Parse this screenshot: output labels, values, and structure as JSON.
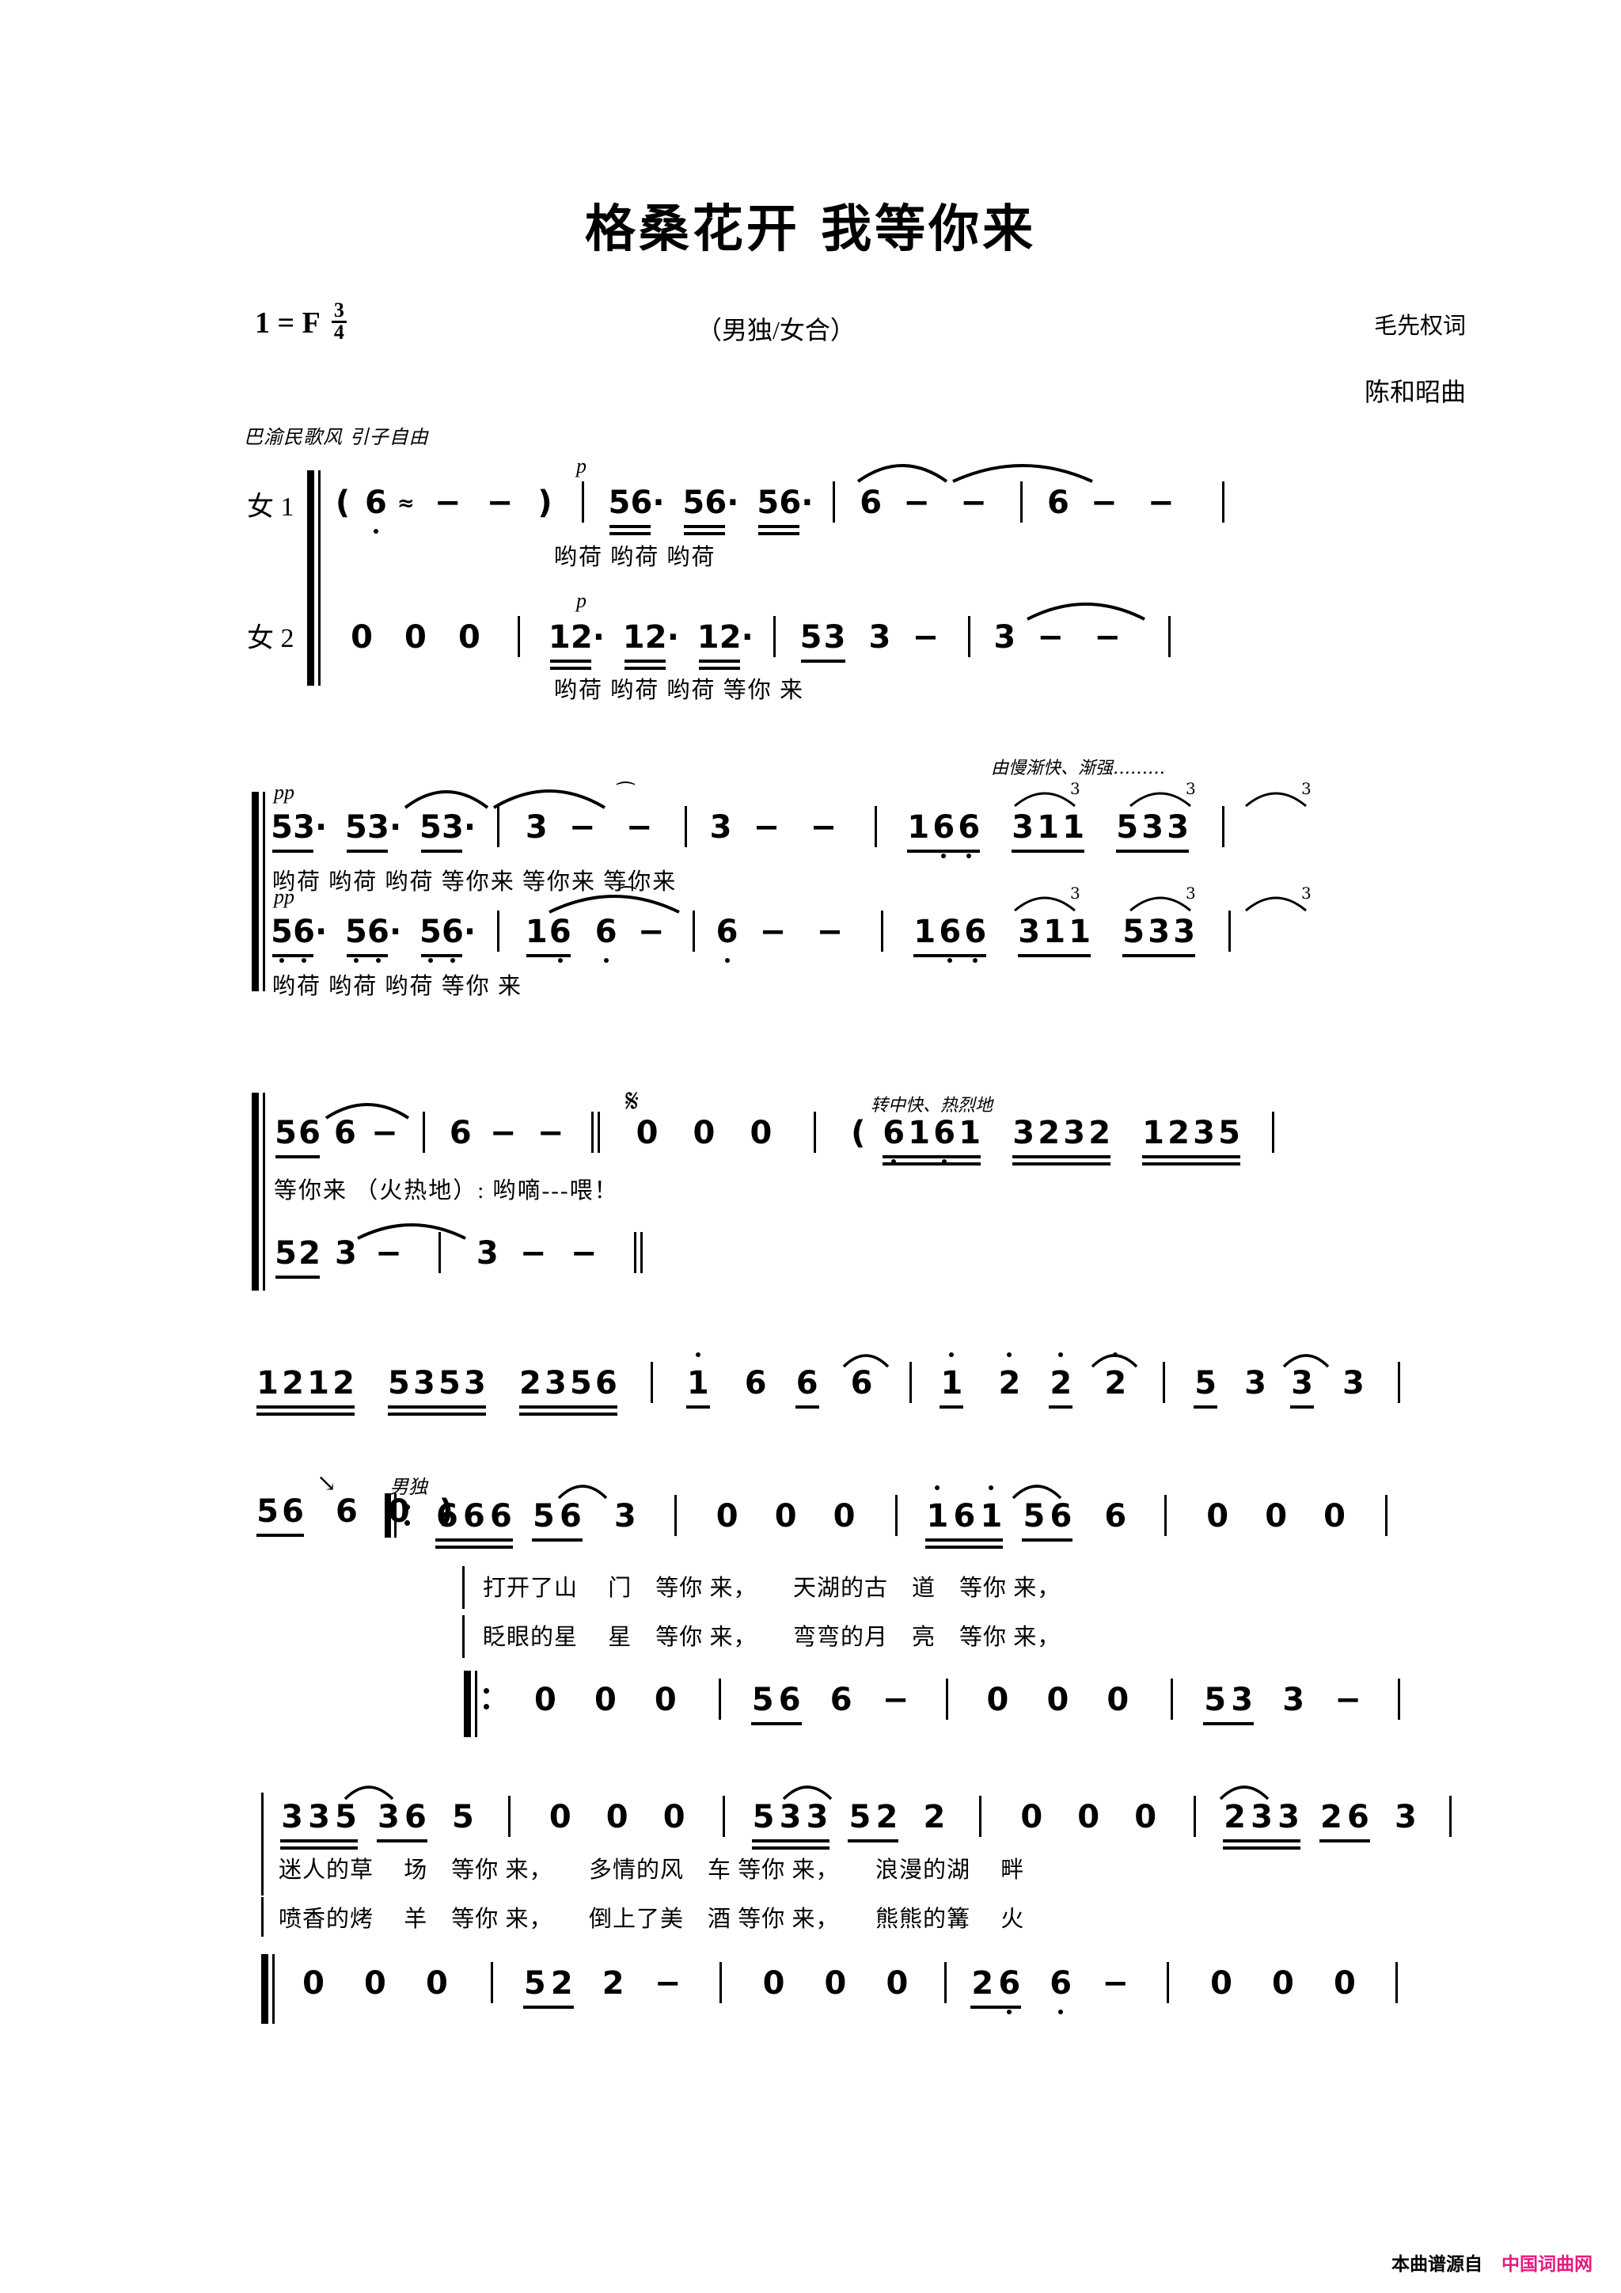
{
  "page": {
    "title": "格桑花开 我等你来",
    "voicing": "（男独/女合）",
    "key_signature": "1 = F",
    "time_numerator": "3",
    "time_denominator": "4",
    "lyricist": "毛先权词",
    "composer": "陈和昭曲",
    "style_note": "巴渝民歌风 引子自由",
    "footer_source": "本曲谱源自",
    "footer_site": "中国词曲网",
    "footer_site_color": "#e8197d"
  },
  "markings": {
    "accel_cresc": "由慢渐快、渐强………",
    "moderato_fervent": "转中快、热烈地",
    "fiery": "（火热地）:",
    "male_solo": "男独",
    "dyn_p": "p",
    "dyn_pp": "pp"
  },
  "voice_labels": {
    "female1": "女 1",
    "female2": "女 2"
  },
  "systems": [
    {
      "id": "system-1",
      "staves": [
        {
          "id": "s1-v1",
          "label": "女 1",
          "notes": "( 6̣ ≈ - - )  | 5 6·  5 6·  5 6· | 6 - - | 6 - - |",
          "lyrics": "哟荷  哟荷  哟荷"
        },
        {
          "id": "s1-v2",
          "label": "女 2",
          "notes": "0  0  0 | 1 2·  1 2·  1 2· | 5 3 3 - | 3 - - |",
          "lyrics": "哟荷  哟荷  哟荷    等你 来"
        }
      ]
    },
    {
      "id": "system-2",
      "staves": [
        {
          "id": "s2-v1",
          "notes": "5 3·  5 3·  5 3· | 3 - - | 3 - - | 1 6 6  3 1 1  5 3 3 |",
          "lyrics": "哟荷  哟荷  哟荷            等你来 等你来 等你来",
          "triplets": [
            "3",
            "3",
            "3"
          ]
        },
        {
          "id": "s2-v2",
          "notes": "5 6·  5 6·  5 6· | 1 6 6 - | 6 - - | 1 6 6  3 1 1  5 3 3 |",
          "lyrics": "哟荷  哟荷  哟荷    等你 来",
          "triplets": [
            "3",
            "3",
            "3"
          ]
        }
      ]
    },
    {
      "id": "system-3",
      "staves": [
        {
          "id": "s3-v1",
          "notes": "5 6 6 - | 6 - - ‖ 0  0  0 | ( 6 1 6 1  3 2 3 2  1 2 3 5 |",
          "lyrics": "等你来            （火热地）: 哟嘀---喂！"
        },
        {
          "id": "s3-v2",
          "notes": "5 2 3 - | 3 - - ‖"
        }
      ]
    },
    {
      "id": "system-4",
      "staves": [
        {
          "id": "s4-inst",
          "notes": "1 2 1 2  5 3 5 3  2 3 5 6 | 1̇ 6 6 6 | 1̇ 2̇ 2̇ 2̇ | 5 3 3 3 |"
        }
      ]
    },
    {
      "id": "system-5",
      "staves": [
        {
          "id": "s5-v1",
          "pickup": "5 6  6 0 )",
          "notes": "‖: 6 6 6 5 6  3 | 0  0  0 | 1̇ 6 1̇ 5 6 6 | 0  0  0 |",
          "lyrics_line1": "打开了山　 门　等你 来，　　天湖的古　道　等你 来，",
          "lyrics_line2": "眨眼的星　 星　等你 来，　　弯弯的月　亮　等你 来，"
        },
        {
          "id": "s5-acc",
          "notes": "‖: 0  0  0 | 5 6 6 - | 0  0  0 | 5 3 3 - |"
        }
      ]
    },
    {
      "id": "system-6",
      "staves": [
        {
          "id": "s6-v1",
          "notes": "3 3 5 3 6 5 | 0  0  0 | 5 3 3 5 2 2 | 0  0  0 | 2 3 3 2 6 3 |",
          "lyrics_line1": "迷人的草　 场　等你 来，　　多情的风　车 等你 来，　　浪漫的湖　 畔",
          "lyrics_line2": "喷香的烤　 羊　等你 来，　　倒上了美　酒 等你 来，　　熊熊的篝　 火"
        },
        {
          "id": "s6-acc",
          "notes": "‖ 0  0  0 | 5 2 2 - | 0  0  0 | 2 6 6 - | 0  0  0 |"
        }
      ]
    }
  ]
}
